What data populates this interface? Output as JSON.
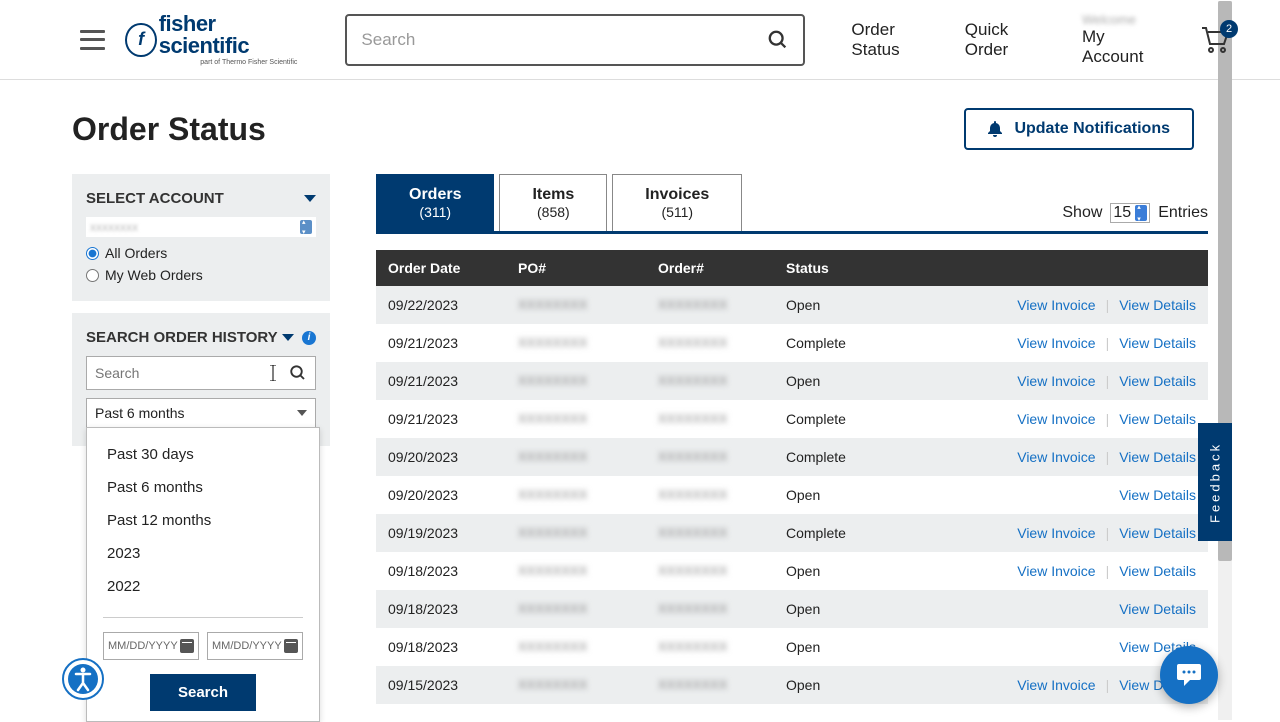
{
  "header": {
    "logo_main": "fisher scientific",
    "logo_sub": "part of Thermo Fisher Scientific",
    "search_placeholder": "Search",
    "nav": {
      "order_status": "Order Status",
      "quick_order": "Quick Order"
    },
    "account": {
      "greeting": "Welcome",
      "my_account": "My Account"
    },
    "cart_count": "2"
  },
  "page": {
    "title": "Order Status",
    "update_btn": "Update Notifications"
  },
  "sidebar": {
    "select_account": {
      "title": "SELECT ACCOUNT",
      "value": "xxxxxxxx",
      "all_orders": "All Orders",
      "my_web_orders": "My Web Orders"
    },
    "search_history": {
      "title": "SEARCH ORDER HISTORY",
      "placeholder": "Search",
      "selected": "Past 6 months",
      "options": [
        "Past 30 days",
        "Past 6 months",
        "Past 12 months",
        "2023",
        "2022"
      ],
      "date_placeholder": "MM/DD/YYYY",
      "search_btn": "Search"
    }
  },
  "tabs": {
    "orders": {
      "label": "Orders",
      "count": "(311)"
    },
    "items": {
      "label": "Items",
      "count": "(858)"
    },
    "invoices": {
      "label": "Invoices",
      "count": "(511)"
    }
  },
  "entries": {
    "show": "Show",
    "value": "15",
    "label": "Entries"
  },
  "table": {
    "headers": {
      "date": "Order Date",
      "po": "PO#",
      "order": "Order#",
      "status": "Status"
    },
    "actions": {
      "invoice": "View Invoice",
      "details": "View Details"
    },
    "rows": [
      {
        "date": "09/22/2023",
        "status": "Open",
        "invoice": true
      },
      {
        "date": "09/21/2023",
        "status": "Complete",
        "invoice": true
      },
      {
        "date": "09/21/2023",
        "status": "Open",
        "invoice": true
      },
      {
        "date": "09/21/2023",
        "status": "Complete",
        "invoice": true
      },
      {
        "date": "09/20/2023",
        "status": "Complete",
        "invoice": true
      },
      {
        "date": "09/20/2023",
        "status": "Open",
        "invoice": false
      },
      {
        "date": "09/19/2023",
        "status": "Complete",
        "invoice": true
      },
      {
        "date": "09/18/2023",
        "status": "Open",
        "invoice": true
      },
      {
        "date": "09/18/2023",
        "status": "Open",
        "invoice": false
      },
      {
        "date": "09/18/2023",
        "status": "Open",
        "invoice": false
      },
      {
        "date": "09/15/2023",
        "status": "Open",
        "invoice": true
      }
    ]
  },
  "feedback": "Feedback"
}
